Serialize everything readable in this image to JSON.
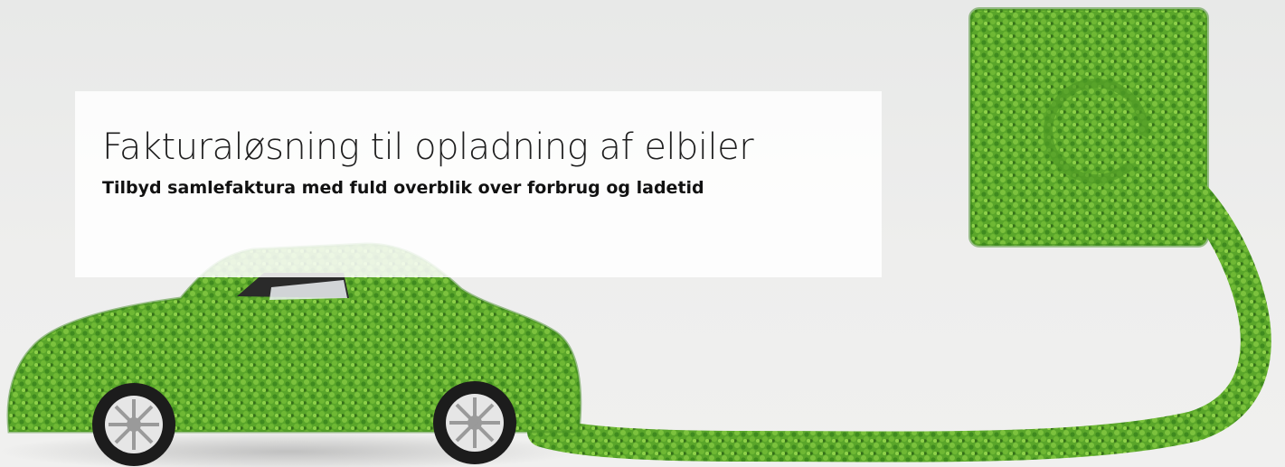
{
  "hero": {
    "title": "Fakturaløsning til opladning af elbiler",
    "subtitle": "Tilbyd samlefaktura med fuld overblik over forbrug og ladetid",
    "image": "green-grass-electric-car-plugged-into-socket",
    "colors": {
      "grass_dark": "#3f8a1f",
      "grass_mid": "#5aa62a",
      "grass_light": "#7cc23d",
      "background": "#ececeb",
      "card": "#ffffff",
      "text": "#1f1f1f"
    }
  }
}
